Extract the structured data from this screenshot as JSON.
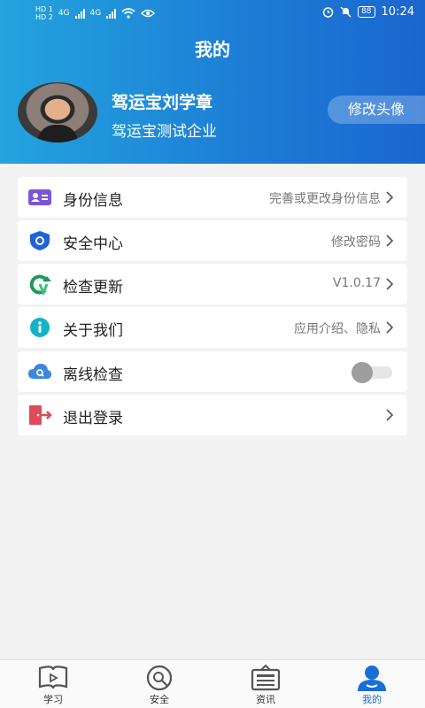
{
  "status_bar": {
    "left_hd1": "HD 1",
    "left_hd2": "HD 2",
    "net1": "4G",
    "net2": "4G",
    "battery": "88",
    "time": "10:24"
  },
  "header": {
    "title": "我的"
  },
  "profile": {
    "name": "驾运宝刘学章",
    "company": "驾运宝测试企业",
    "change_avatar": "修改头像"
  },
  "menu": [
    {
      "label": "身份信息",
      "sub": "完善或更改身份信息",
      "icon": "id-card-icon"
    },
    {
      "label": "安全中心",
      "sub": "修改密码",
      "icon": "shield-icon"
    },
    {
      "label": "检查更新",
      "sub": "V1.0.17",
      "icon": "update-icon"
    },
    {
      "label": "关于我们",
      "sub": "应用介绍、隐私",
      "icon": "info-icon"
    },
    {
      "label": "离线检查",
      "sub": "",
      "icon": "cloud-search-icon",
      "toggle_on": false
    },
    {
      "label": "退出登录",
      "sub": "",
      "icon": "logout-icon"
    }
  ],
  "tabs": [
    {
      "label": "学习",
      "icon": "book-play-icon"
    },
    {
      "label": "安全",
      "icon": "safety-search-icon"
    },
    {
      "label": "资讯",
      "icon": "news-icon"
    },
    {
      "label": "我的",
      "icon": "user-icon",
      "active": true
    }
  ],
  "colors": {
    "header_start": "#23a4de",
    "header_end": "#1a66cf",
    "accent": "#1a6ed8"
  }
}
